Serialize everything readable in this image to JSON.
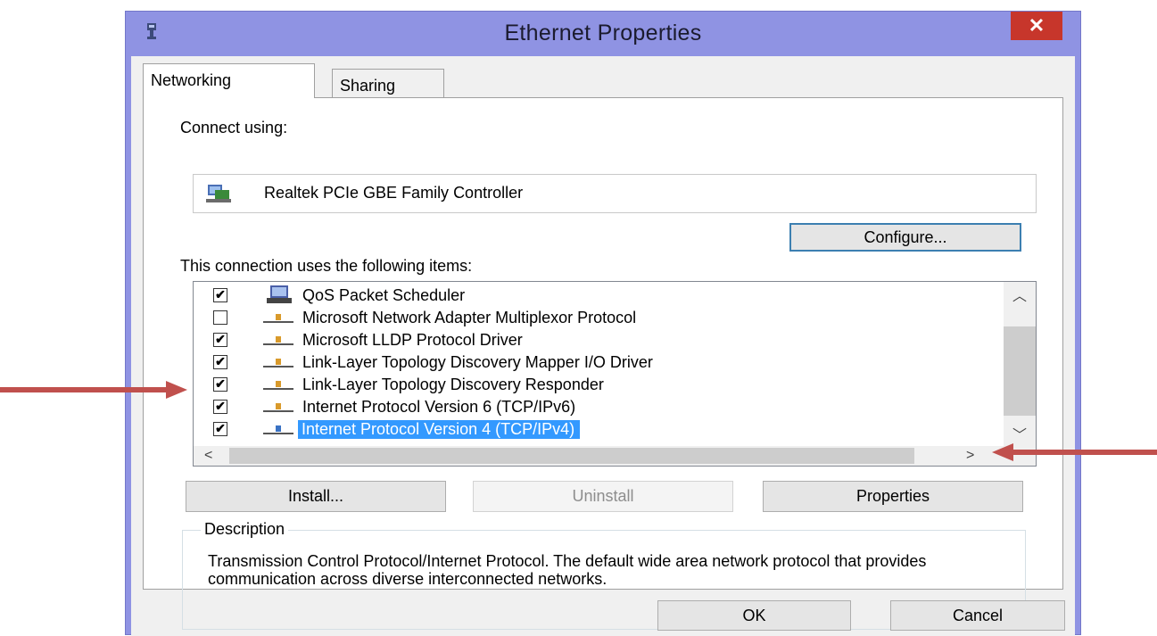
{
  "window": {
    "title": "Ethernet Properties",
    "close_label": "✕"
  },
  "tabs": [
    {
      "label": "Networking",
      "active": true
    },
    {
      "label": "Sharing",
      "active": false
    }
  ],
  "connect_using": {
    "label": "Connect using:",
    "adapter_name": "Realtek PCIe GBE Family Controller",
    "configure_label": "Configure..."
  },
  "items": {
    "label": "This connection uses the following items:",
    "list": [
      {
        "label": "QoS Packet Scheduler",
        "checked": true,
        "icon": "network-service-icon"
      },
      {
        "label": "Microsoft Network Adapter Multiplexor Protocol",
        "checked": false,
        "icon": "network-protocol-icon"
      },
      {
        "label": "Microsoft LLDP Protocol Driver",
        "checked": true,
        "icon": "network-protocol-icon"
      },
      {
        "label": "Link-Layer Topology Discovery Mapper I/O Driver",
        "checked": true,
        "icon": "network-protocol-icon"
      },
      {
        "label": "Link-Layer Topology Discovery Responder",
        "checked": true,
        "icon": "network-protocol-icon"
      },
      {
        "label": "Internet Protocol Version 6 (TCP/IPv6)",
        "checked": true,
        "icon": "network-protocol-icon"
      },
      {
        "label": "Internet Protocol Version 4 (TCP/IPv4)",
        "checked": true,
        "icon": "network-protocol-icon",
        "selected": true
      }
    ]
  },
  "buttons": {
    "install": "Install...",
    "uninstall": "Uninstall",
    "properties": "Properties",
    "ok": "OK",
    "cancel": "Cancel"
  },
  "description": {
    "legend": "Description",
    "text": "Transmission Control Protocol/Internet Protocol. The default wide area network protocol that provides communication across diverse interconnected networks."
  },
  "colors": {
    "titlebar": "#8f93e3",
    "close": "#c7362b",
    "selection": "#3399ff",
    "annotation_arrow": "#c0504d"
  }
}
